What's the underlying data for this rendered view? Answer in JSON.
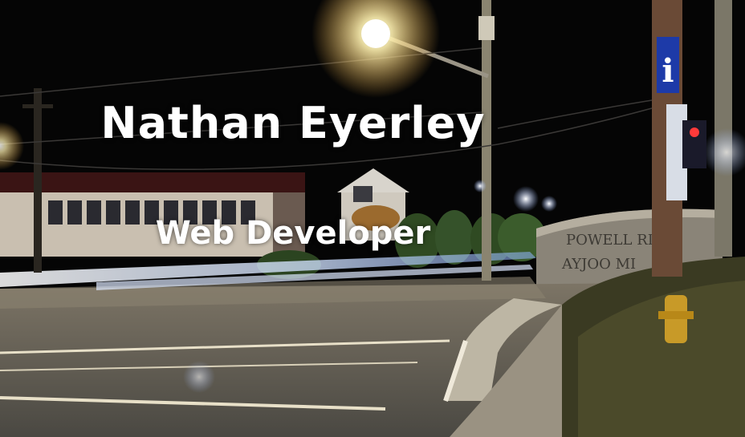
{
  "hero": {
    "name": "Nathan Eyerley",
    "role": "Web Developer"
  },
  "colors": {
    "sky": "#050505",
    "street_light": "#fff3c0",
    "road": "#6e6a5e",
    "light_trail": "#c8d8ff",
    "hedge": "#2f4a22",
    "sign_blue": "#1d3aa8"
  }
}
